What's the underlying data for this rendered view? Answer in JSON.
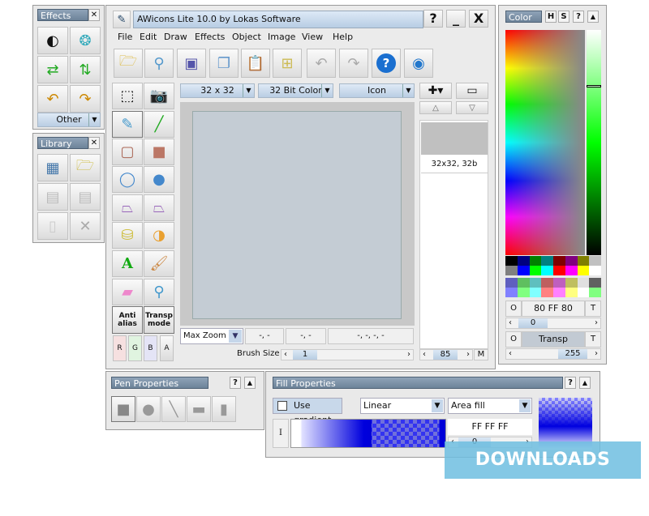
{
  "effects": {
    "title": "Effects",
    "other_label": "Other",
    "icons": [
      "sphere-icon",
      "circle-blue-icon",
      "swap-horizontal-icon",
      "swap-vertical-icon",
      "rotate-left-icon",
      "rotate-right-icon"
    ]
  },
  "library": {
    "title": "Library",
    "icons": [
      "new-library-icon",
      "open-library-icon",
      "save-library-icon",
      "save-icl-icon",
      "blank-page-icon",
      "delete-icon"
    ]
  },
  "window": {
    "title": "AWicons Lite 10.0 by Lokas Software",
    "help": "?",
    "minimize": "_",
    "close": "X"
  },
  "menu": [
    "File",
    "Edit",
    "Draw",
    "Effects",
    "Object",
    "Image",
    "View",
    "Help"
  ],
  "toolbar": [
    "open-icon",
    "zoom-icon",
    "save-icon",
    "copy-icon",
    "paste-icon",
    "paste-new-icon",
    "undo-icon",
    "redo-icon",
    "help-icon",
    "web-icon"
  ],
  "tools": {
    "anti_alias": "Anti alias",
    "transp_mode": "Transp mode",
    "channels": [
      "R",
      "G",
      "B",
      "A"
    ]
  },
  "image_options": {
    "size": "32 x 32",
    "depth": "32 Bit Color",
    "type": "Icon"
  },
  "preview": {
    "label": "32x32, 32b"
  },
  "status": {
    "zoom": "Max Zoom",
    "pos1": "-, -",
    "pos2": "-, -",
    "pos3": "-, -, -, -",
    "brush_label": "Brush Size",
    "brush_value": "1",
    "list_value": "85",
    "m": "M"
  },
  "color": {
    "title": "Color",
    "h": "H",
    "s": "S",
    "help": "?",
    "collapse": "▲",
    "current": "80 FF 80",
    "current_color": "#80ff80",
    "alpha": "0",
    "transp": "Transp",
    "transp_value": "255",
    "o": "O",
    "t": "T",
    "palette": [
      "#000000",
      "#000080",
      "#008000",
      "#008080",
      "#800000",
      "#800080",
      "#808000",
      "#c0c0c0",
      "#808080",
      "#0000ff",
      "#00ff00",
      "#00ffff",
      "#ff0000",
      "#ff00ff",
      "#ffff00",
      "#ffffff",
      "#5f5fbf",
      "#5fbf5f",
      "#5fbfbf",
      "#bf5f5f",
      "#bf5fbf",
      "#bfbf5f",
      "#e0e0e0",
      "#606060",
      "#8080ff",
      "#80ff80",
      "#80ffff",
      "#ff8080",
      "#ff80ff",
      "#ffff80",
      "#ffffff",
      "#80ff80"
    ]
  },
  "pen": {
    "title": "Pen Properties",
    "help": "?",
    "collapse": "▲"
  },
  "fill": {
    "title": "Fill Properties",
    "help": "?",
    "collapse": "▲",
    "use_gradient": "Use gradient",
    "gradient_type": "Linear",
    "fill_mode": "Area fill",
    "stop_color": "FF FF FF",
    "stop_value": "0",
    "cursor": "I"
  },
  "watermark": "DOWNLOADS GURU"
}
